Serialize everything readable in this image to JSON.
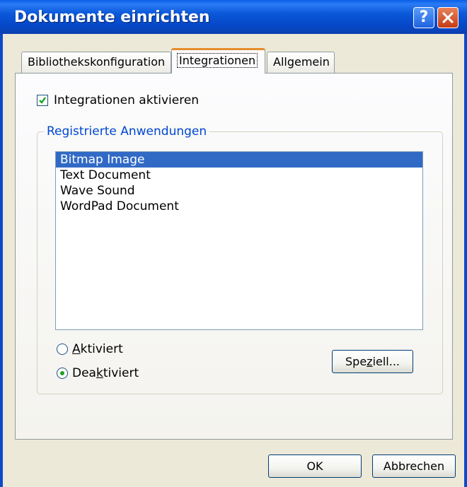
{
  "window": {
    "title": "Dokumente einrichten",
    "help_label": "?"
  },
  "tabs": [
    {
      "label": "Bibliothekskonfiguration",
      "active": false
    },
    {
      "label": "Integrationen",
      "active": true
    },
    {
      "label": "Allgemein",
      "active": false
    }
  ],
  "integrations": {
    "enable_checkbox": {
      "label": "Integrationen aktivieren",
      "checked": true
    },
    "group_title": "Registrierte Anwendungen",
    "applications": [
      {
        "label": "Bitmap Image",
        "selected": true
      },
      {
        "label": "Text Document",
        "selected": false
      },
      {
        "label": "Wave Sound",
        "selected": false
      },
      {
        "label": "WordPad Document",
        "selected": false
      }
    ],
    "radio_activated": {
      "prefix": "",
      "accel": "A",
      "rest": "ktiviert",
      "checked": false
    },
    "radio_deactivated": {
      "prefix": "Dea",
      "accel": "k",
      "rest": "tiviert",
      "checked": true
    },
    "special_button": {
      "prefix": "Spe",
      "accel": "z",
      "rest": "iell..."
    }
  },
  "footer": {
    "ok_label": "OK",
    "cancel_label": "Abbrechen"
  },
  "colors": {
    "titlebar": "#0a58d9",
    "selection": "#316ac5",
    "active_tab_accent": "#e68b2c",
    "check_green": "#21a121"
  }
}
